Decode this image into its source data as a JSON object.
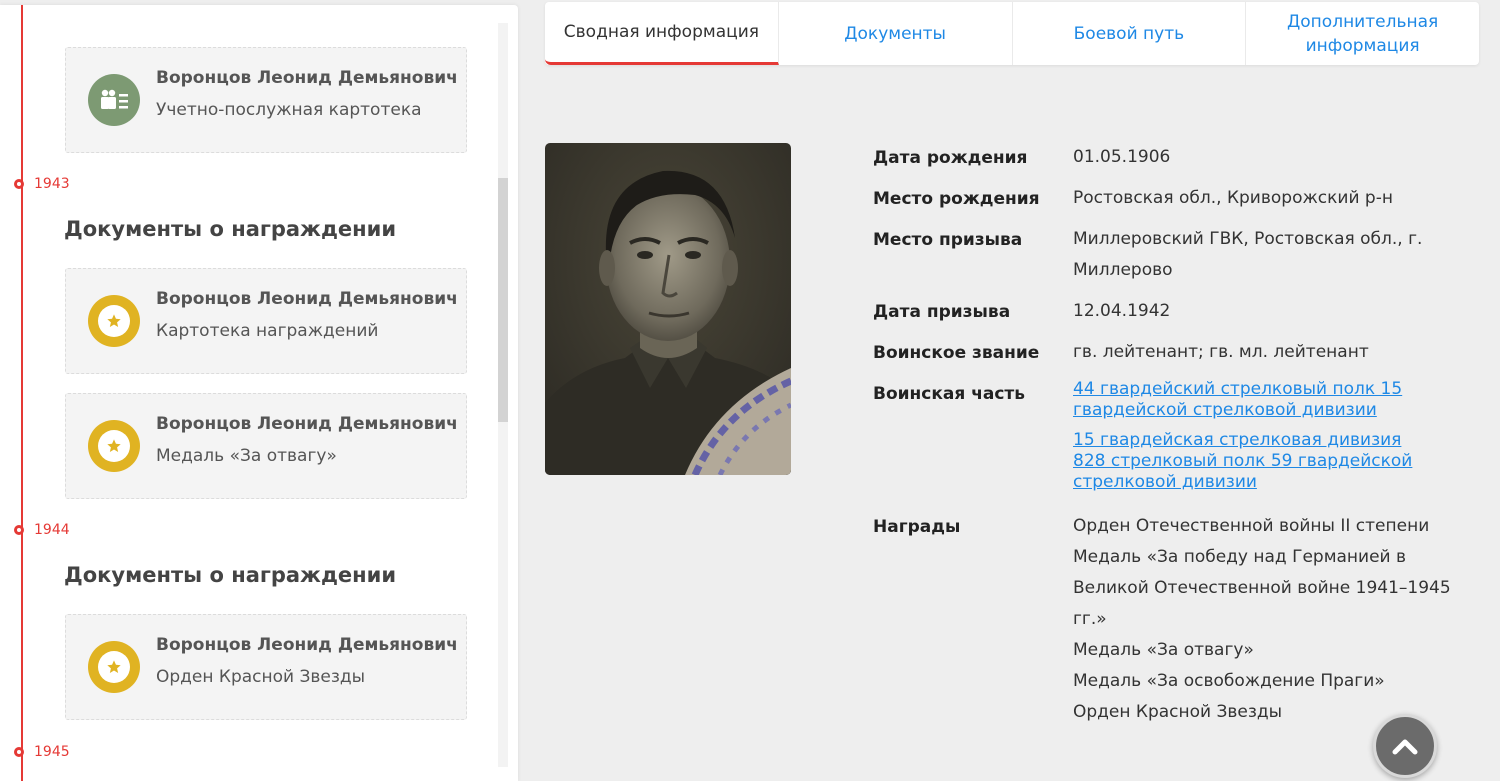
{
  "timeline": {
    "years": [
      "1943",
      "1944",
      "1945"
    ]
  },
  "sections": [
    {
      "title": "Документы о награждении"
    },
    {
      "title": "Документы о награждении"
    }
  ],
  "cards": [
    {
      "name": "Воронцов Леонид Демьянович",
      "type": "Учетно-послужная картотека",
      "icon": "person-card-icon"
    },
    {
      "name": "Воронцов Леонид Демьянович",
      "type": "Картотека награждений",
      "icon": "medal-icon"
    },
    {
      "name": "Воронцов Леонид Демьянович",
      "type": "Медаль «За отвагу»",
      "icon": "medal-icon"
    },
    {
      "name": "Воронцов Леонид Демьянович",
      "type": "Орден Красной Звезды",
      "icon": "medal-icon"
    }
  ],
  "tabs": [
    {
      "label": "Сводная информация"
    },
    {
      "label": "Документы"
    },
    {
      "label": "Боевой путь"
    },
    {
      "label": "Дополнительная информация"
    }
  ],
  "info": {
    "birth_date": {
      "label": "Дата рождения",
      "value": "01.05.1906"
    },
    "birth_place": {
      "label": "Место рождения",
      "value": "Ростовская обл., Криворожский р-н"
    },
    "conscription_place": {
      "label": "Место призыва",
      "value": "Миллеровский ГВК, Ростовская обл., г. Миллерово"
    },
    "conscription_date": {
      "label": "Дата призыва",
      "value": "12.04.1942"
    },
    "rank": {
      "label": "Воинское звание",
      "value": "гв. лейтенант; гв. мл. лейтенант"
    },
    "unit": {
      "label": "Воинская часть",
      "links": [
        "44 гвардейский стрелковый полк 15 гвардейской стрелковой дивизии",
        "15 гвардейская стрелковая дивизия",
        "828 стрелковый полк 59 гвардейской стрелковой дивизии"
      ]
    },
    "awards": {
      "label": "Награды",
      "items": [
        "Орден Отечественной войны II степени",
        "Медаль «За победу над Германией в Великой Отечественной войне 1941–1945 гг.»",
        "Медаль «За отвагу»",
        "Медаль «За освобождение Праги»",
        "Орден Красной Звезды"
      ]
    }
  },
  "colors": {
    "accent_red": "#e53935",
    "link_blue": "#1e88e5",
    "medal_gold": "#e0b322",
    "card_green": "#7d9a73"
  }
}
